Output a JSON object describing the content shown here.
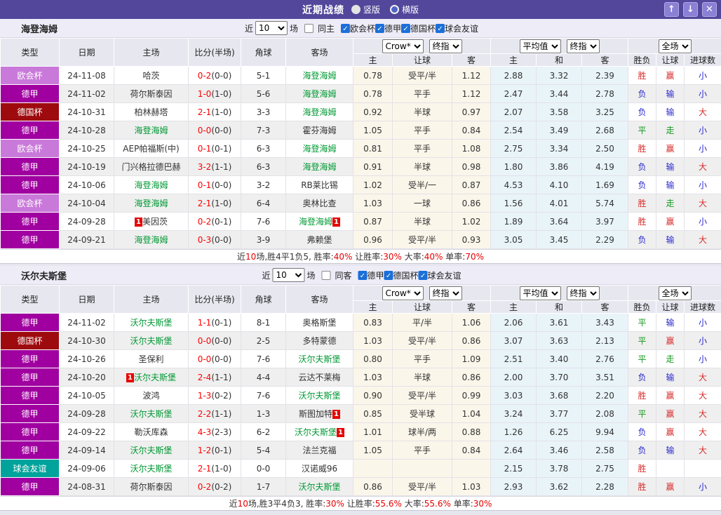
{
  "titlebar": {
    "title": "近期战绩",
    "radio_vertical_label": "竖版",
    "radio_horizontal_label": "横版",
    "radio_selected": "竖版",
    "up_icon": "↑",
    "down_icon": "↓",
    "close_icon": "✕"
  },
  "filter_labels": {
    "near": "近",
    "count": "10",
    "games": "场"
  },
  "card_badge": "1",
  "table_header": {
    "left_cols": [
      "类型",
      "日期",
      "主场",
      "比分(半场)",
      "角球",
      "客场"
    ],
    "ah_cols": [
      "主",
      "让球",
      "客"
    ],
    "eu_cols": [
      "主",
      "和",
      "客"
    ],
    "res_cols": [
      "胜负",
      "让球",
      "进球数"
    ],
    "dropdowns": {
      "ah_source": "Crow*",
      "ah_time": "终指",
      "eu_source": "平均值",
      "eu_time": "终指",
      "scope": "全场"
    }
  },
  "type_colors": {
    "欧会杯": "#c979d9",
    "德甲": "#a000a0",
    "德国杯": "#9e0b0f",
    "球会友谊": "#00a39b"
  },
  "result_color_map": {
    "胜": "t-red",
    "赢": "t-red",
    "大": "t-red",
    "负": "t-blue",
    "输": "t-blue",
    "小": "t-blue",
    "平": "t-green",
    "走": "t-green"
  },
  "sections": [
    {
      "team": "海登海姆",
      "same_label": "同主",
      "same_checked": false,
      "leagues": [
        "欧会杯",
        "德甲",
        "德国杯",
        "球会友谊"
      ],
      "rows": [
        {
          "type": "欧会杯",
          "date": "24-11-08",
          "home": "哈茨",
          "home_self": false,
          "home_card": false,
          "score": "0-2",
          "half": "(0-0)",
          "corner": "5-1",
          "away": "海登海姆",
          "away_self": true,
          "away_card": false,
          "ah": [
            "0.78",
            "受平/半",
            "1.12"
          ],
          "eu": [
            "2.88",
            "3.32",
            "2.39"
          ],
          "res": [
            "胜",
            "赢",
            "小"
          ]
        },
        {
          "type": "德甲",
          "date": "24-11-02",
          "home": "荷尔斯泰因",
          "home_self": false,
          "home_card": false,
          "score": "1-0",
          "half": "(1-0)",
          "corner": "5-6",
          "away": "海登海姆",
          "away_self": true,
          "away_card": false,
          "ah": [
            "0.78",
            "平手",
            "1.12"
          ],
          "eu": [
            "2.47",
            "3.44",
            "2.78"
          ],
          "res": [
            "负",
            "输",
            "小"
          ]
        },
        {
          "type": "德国杯",
          "date": "24-10-31",
          "home": "柏林赫塔",
          "home_self": false,
          "home_card": false,
          "score": "2-1",
          "half": "(1-0)",
          "corner": "3-3",
          "away": "海登海姆",
          "away_self": true,
          "away_card": false,
          "ah": [
            "0.92",
            "半球",
            "0.97"
          ],
          "eu": [
            "2.07",
            "3.58",
            "3.25"
          ],
          "res": [
            "负",
            "输",
            "大"
          ]
        },
        {
          "type": "德甲",
          "date": "24-10-28",
          "home": "海登海姆",
          "home_self": true,
          "home_card": false,
          "score": "0-0",
          "half": "(0-0)",
          "corner": "7-3",
          "away": "霍芬海姆",
          "away_self": false,
          "away_card": false,
          "ah": [
            "1.05",
            "平手",
            "0.84"
          ],
          "eu": [
            "2.54",
            "3.49",
            "2.68"
          ],
          "res": [
            "平",
            "走",
            "小"
          ]
        },
        {
          "type": "欧会杯",
          "date": "24-10-25",
          "home": "AEP帕福斯(中)",
          "home_self": false,
          "home_card": false,
          "score": "0-1",
          "half": "(0-1)",
          "corner": "6-3",
          "away": "海登海姆",
          "away_self": true,
          "away_card": false,
          "ah": [
            "0.81",
            "平手",
            "1.08"
          ],
          "eu": [
            "2.75",
            "3.34",
            "2.50"
          ],
          "res": [
            "胜",
            "赢",
            "小"
          ]
        },
        {
          "type": "德甲",
          "date": "24-10-19",
          "home": "门兴格拉德巴赫",
          "home_self": false,
          "home_card": false,
          "score": "3-2",
          "half": "(1-1)",
          "corner": "6-3",
          "away": "海登海姆",
          "away_self": true,
          "away_card": false,
          "ah": [
            "0.91",
            "半球",
            "0.98"
          ],
          "eu": [
            "1.80",
            "3.86",
            "4.19"
          ],
          "res": [
            "负",
            "输",
            "大"
          ]
        },
        {
          "type": "德甲",
          "date": "24-10-06",
          "home": "海登海姆",
          "home_self": true,
          "home_card": false,
          "score": "0-1",
          "half": "(0-0)",
          "corner": "3-2",
          "away": "RB莱比锡",
          "away_self": false,
          "away_card": false,
          "ah": [
            "1.02",
            "受半/一",
            "0.87"
          ],
          "eu": [
            "4.53",
            "4.10",
            "1.69"
          ],
          "res": [
            "负",
            "输",
            "小"
          ]
        },
        {
          "type": "欧会杯",
          "date": "24-10-04",
          "home": "海登海姆",
          "home_self": true,
          "home_card": false,
          "score": "2-1",
          "half": "(1-0)",
          "corner": "6-4",
          "away": "奥林比查",
          "away_self": false,
          "away_card": false,
          "ah": [
            "1.03",
            "一球",
            "0.86"
          ],
          "eu": [
            "1.56",
            "4.01",
            "5.74"
          ],
          "res": [
            "胜",
            "走",
            "大"
          ]
        },
        {
          "type": "德甲",
          "date": "24-09-28",
          "home": "美因茨",
          "home_self": false,
          "home_card": true,
          "score": "0-2",
          "half": "(0-1)",
          "corner": "7-6",
          "away": "海登海姆",
          "away_self": true,
          "away_card": true,
          "ah": [
            "0.87",
            "半球",
            "1.02"
          ],
          "eu": [
            "1.89",
            "3.64",
            "3.97"
          ],
          "res": [
            "胜",
            "赢",
            "小"
          ]
        },
        {
          "type": "德甲",
          "date": "24-09-21",
          "home": "海登海姆",
          "home_self": true,
          "home_card": false,
          "score": "0-3",
          "half": "(0-0)",
          "corner": "3-9",
          "away": "弗赖堡",
          "away_self": false,
          "away_card": false,
          "ah": [
            "0.96",
            "受平/半",
            "0.93"
          ],
          "eu": [
            "3.05",
            "3.45",
            "2.29"
          ],
          "res": [
            "负",
            "输",
            "大"
          ]
        }
      ],
      "summary": [
        {
          "t": "近"
        },
        {
          "t": "10",
          "red": true
        },
        {
          "t": "场,胜4平1负5, 胜率:"
        },
        {
          "t": "40%",
          "red": true
        },
        {
          "t": " 让胜率:"
        },
        {
          "t": "30%",
          "red": true
        },
        {
          "t": " 大率:"
        },
        {
          "t": "40%",
          "red": true
        },
        {
          "t": " 单率:"
        },
        {
          "t": "70%",
          "red": true
        }
      ]
    },
    {
      "team": "沃尔夫斯堡",
      "same_label": "同客",
      "same_checked": false,
      "leagues": [
        "德甲",
        "德国杯",
        "球会友谊"
      ],
      "rows": [
        {
          "type": "德甲",
          "date": "24-11-02",
          "home": "沃尔夫斯堡",
          "home_self": true,
          "home_card": false,
          "score": "1-1",
          "half": "(0-1)",
          "corner": "8-1",
          "away": "奥格斯堡",
          "away_self": false,
          "away_card": false,
          "ah": [
            "0.83",
            "平/半",
            "1.06"
          ],
          "eu": [
            "2.06",
            "3.61",
            "3.43"
          ],
          "res": [
            "平",
            "输",
            "小"
          ]
        },
        {
          "type": "德国杯",
          "date": "24-10-30",
          "home": "沃尔夫斯堡",
          "home_self": true,
          "home_card": false,
          "score": "0-0",
          "half": "(0-0)",
          "corner": "2-5",
          "away": "多特蒙德",
          "away_self": false,
          "away_card": false,
          "ah": [
            "1.03",
            "受平/半",
            "0.86"
          ],
          "eu": [
            "3.07",
            "3.63",
            "2.13"
          ],
          "res": [
            "平",
            "赢",
            "小"
          ]
        },
        {
          "type": "德甲",
          "date": "24-10-26",
          "home": "圣保利",
          "home_self": false,
          "home_card": false,
          "score": "0-0",
          "half": "(0-0)",
          "corner": "7-6",
          "away": "沃尔夫斯堡",
          "away_self": true,
          "away_card": false,
          "ah": [
            "0.80",
            "平手",
            "1.09"
          ],
          "eu": [
            "2.51",
            "3.40",
            "2.76"
          ],
          "res": [
            "平",
            "走",
            "小"
          ]
        },
        {
          "type": "德甲",
          "date": "24-10-20",
          "home": "沃尔夫斯堡",
          "home_self": true,
          "home_card": true,
          "score": "2-4",
          "half": "(1-1)",
          "corner": "4-4",
          "away": "云达不莱梅",
          "away_self": false,
          "away_card": false,
          "ah": [
            "1.03",
            "半球",
            "0.86"
          ],
          "eu": [
            "2.00",
            "3.70",
            "3.51"
          ],
          "res": [
            "负",
            "输",
            "大"
          ]
        },
        {
          "type": "德甲",
          "date": "24-10-05",
          "home": "波鸿",
          "home_self": false,
          "home_card": false,
          "score": "1-3",
          "half": "(0-2)",
          "corner": "7-6",
          "away": "沃尔夫斯堡",
          "away_self": true,
          "away_card": false,
          "ah": [
            "0.90",
            "受平/半",
            "0.99"
          ],
          "eu": [
            "3.03",
            "3.68",
            "2.20"
          ],
          "res": [
            "胜",
            "赢",
            "大"
          ]
        },
        {
          "type": "德甲",
          "date": "24-09-28",
          "home": "沃尔夫斯堡",
          "home_self": true,
          "home_card": false,
          "score": "2-2",
          "half": "(1-1)",
          "corner": "1-3",
          "away": "斯图加特",
          "away_self": false,
          "away_card": true,
          "ah": [
            "0.85",
            "受半球",
            "1.04"
          ],
          "eu": [
            "3.24",
            "3.77",
            "2.08"
          ],
          "res": [
            "平",
            "赢",
            "大"
          ]
        },
        {
          "type": "德甲",
          "date": "24-09-22",
          "home": "勒沃库森",
          "home_self": false,
          "home_card": false,
          "score": "4-3",
          "half": "(2-3)",
          "corner": "6-2",
          "away": "沃尔夫斯堡",
          "away_self": true,
          "away_card": true,
          "ah": [
            "1.01",
            "球半/两",
            "0.88"
          ],
          "eu": [
            "1.26",
            "6.25",
            "9.94"
          ],
          "res": [
            "负",
            "赢",
            "大"
          ]
        },
        {
          "type": "德甲",
          "date": "24-09-14",
          "home": "沃尔夫斯堡",
          "home_self": true,
          "home_card": false,
          "score": "1-2",
          "half": "(0-1)",
          "corner": "5-4",
          "away": "法兰克福",
          "away_self": false,
          "away_card": false,
          "ah": [
            "1.05",
            "平手",
            "0.84"
          ],
          "eu": [
            "2.64",
            "3.46",
            "2.58"
          ],
          "res": [
            "负",
            "输",
            "大"
          ]
        },
        {
          "type": "球会友谊",
          "date": "24-09-06",
          "home": "沃尔夫斯堡",
          "home_self": true,
          "home_card": false,
          "score": "2-1",
          "half": "(1-0)",
          "corner": "0-0",
          "away": "汉诺威96",
          "away_self": false,
          "away_card": false,
          "ah": [
            "",
            "",
            ""
          ],
          "eu": [
            "2.15",
            "3.78",
            "2.75"
          ],
          "res": [
            "胜",
            "",
            ""
          ]
        },
        {
          "type": "德甲",
          "date": "24-08-31",
          "home": "荷尔斯泰因",
          "home_self": false,
          "home_card": false,
          "score": "0-2",
          "half": "(0-2)",
          "corner": "1-7",
          "away": "沃尔夫斯堡",
          "away_self": true,
          "away_card": false,
          "ah": [
            "0.86",
            "受平/半",
            "1.03"
          ],
          "eu": [
            "2.93",
            "3.62",
            "2.28"
          ],
          "res": [
            "胜",
            "赢",
            "小"
          ]
        }
      ],
      "summary": [
        {
          "t": "近"
        },
        {
          "t": "10",
          "red": true
        },
        {
          "t": "场,胜3平4负3, 胜率:"
        },
        {
          "t": "30%",
          "red": true
        },
        {
          "t": " 让胜率:"
        },
        {
          "t": "55.6%",
          "red": true
        },
        {
          "t": " 大率:"
        },
        {
          "t": "55.6%",
          "red": true
        },
        {
          "t": " 单率:"
        },
        {
          "t": "30%",
          "red": true
        }
      ]
    }
  ]
}
